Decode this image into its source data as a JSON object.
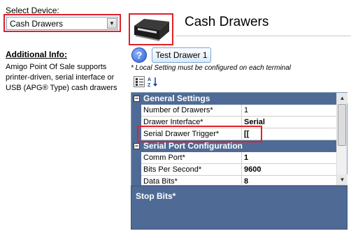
{
  "select_device": {
    "label": "Select Device:",
    "value": "Cash Drawers"
  },
  "info": {
    "title": "Additional Info:",
    "text": "Amigo Point Of Sale supports printer-driven, serial interface or USB (APG® Type) cash drawers"
  },
  "header": {
    "title": "Cash Drawers"
  },
  "actions": {
    "help_label": "?",
    "test_label": "Test Drawer 1"
  },
  "note": "* Local Setting must be configured on each terminal",
  "grid": {
    "categories": [
      {
        "title": "General Settings",
        "toggle": "−",
        "rows": [
          {
            "name": "Number of Drawers*",
            "value": "1",
            "bold": false
          },
          {
            "name": "Drawer Interface*",
            "value": "Serial",
            "bold": true
          },
          {
            "name": "Serial Drawer Trigger*",
            "value": "[[",
            "bold": true
          }
        ]
      },
      {
        "title": "Serial Port Configuration",
        "toggle": "−",
        "rows": [
          {
            "name": "Comm Port*",
            "value": "1",
            "bold": true
          },
          {
            "name": "Bits Per Second*",
            "value": "9600",
            "bold": true
          },
          {
            "name": "Data Bits*",
            "value": "8",
            "bold": true
          }
        ]
      }
    ]
  },
  "description": {
    "title": "Stop Bits*"
  },
  "colors": {
    "highlight": "#e0202a",
    "grid_header": "#4f6b95"
  }
}
